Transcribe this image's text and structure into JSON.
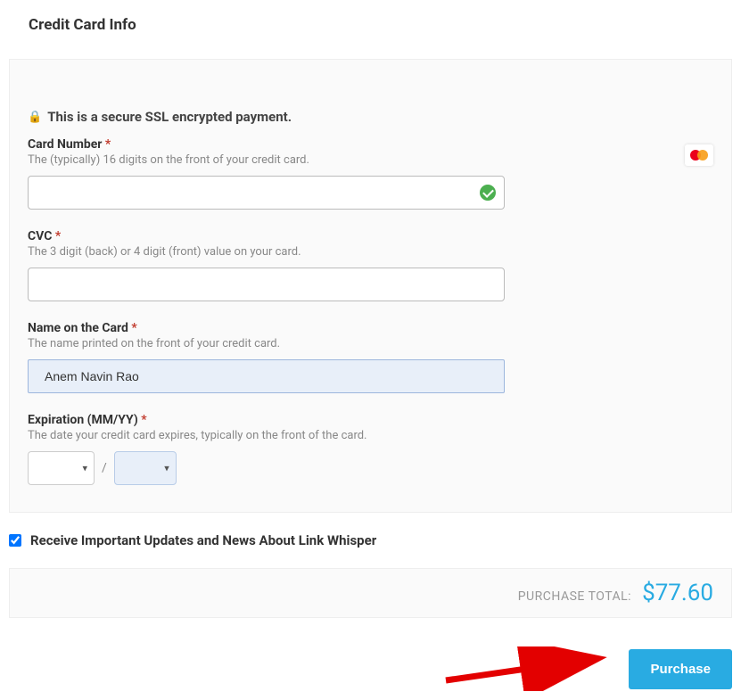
{
  "section": {
    "title": "Credit Card Info",
    "secure_text": "This is a secure SSL encrypted payment."
  },
  "card_number": {
    "label": "Card Number",
    "required": "*",
    "help": "The (typically) 16 digits on the front of your credit card.",
    "value": ""
  },
  "cvc": {
    "label": "CVC",
    "required": "*",
    "help": "The 3 digit (back) or 4 digit (front) value on your card.",
    "value": ""
  },
  "name": {
    "label": "Name on the Card",
    "required": "*",
    "help": "The name printed on the front of your credit card.",
    "value": "Anem Navin Rao"
  },
  "expiration": {
    "label": "Expiration (MM/YY)",
    "required": "*",
    "help": "The date your credit card expires, typically on the front of the card.",
    "month": "",
    "year": "",
    "separator": "/"
  },
  "updates": {
    "checked": true,
    "label": "Receive Important Updates and News About Link Whisper"
  },
  "total": {
    "label": "PURCHASE TOTAL:",
    "amount": "$77.60"
  },
  "purchase_button": "Purchase"
}
